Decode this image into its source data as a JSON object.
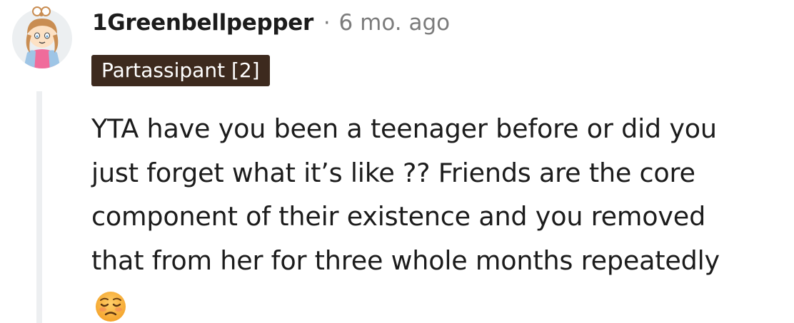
{
  "comment": {
    "author": "1Greenbellpepper",
    "separator": "·",
    "time_ago": "6 mo. ago",
    "flair": "Partassipant [2]",
    "body_lines": [
      "YTA have you been a teenager before or did you",
      "just forget what it’s like ?? Friends are the core",
      "component of their existence and you removed",
      "that from her for three whole months repeatedly"
    ],
    "emoji": "unamused-face-icon"
  },
  "colors": {
    "flair_bg": "#3d2a1e",
    "flair_text": "#ffffff",
    "meta_gray": "#7c7c7c",
    "thread_line": "#edeff1"
  }
}
